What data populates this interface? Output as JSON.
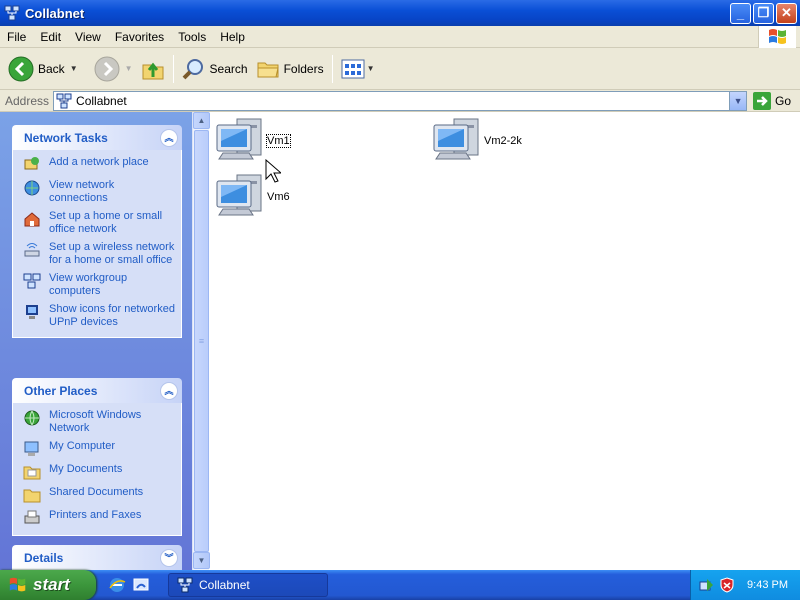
{
  "window": {
    "title": "Collabnet",
    "icon": "network-icon",
    "controls": [
      "minimize-icon",
      "maximize-icon",
      "close-icon"
    ]
  },
  "menubar": {
    "items": [
      "File",
      "Edit",
      "View",
      "Favorites",
      "Tools",
      "Help"
    ]
  },
  "toolbar": {
    "back_label": "Back",
    "search_label": "Search",
    "folders_label": "Folders"
  },
  "address": {
    "label": "Address",
    "value": "Collabnet",
    "go_label": "Go"
  },
  "network_tasks": {
    "title": "Network Tasks",
    "items": [
      {
        "label": "Add a network place",
        "icon": "add-network-place-icon"
      },
      {
        "label": "View network connections",
        "icon": "network-connections-icon"
      },
      {
        "label": "Set up a home or small office network",
        "icon": "home-network-icon"
      },
      {
        "label": "Set up a wireless network for a home or small office",
        "icon": "wireless-network-icon"
      },
      {
        "label": "View workgroup computers",
        "icon": "workgroup-icon"
      },
      {
        "label": "Show icons for networked UPnP devices",
        "icon": "upnp-icon"
      }
    ]
  },
  "other_places": {
    "title": "Other Places",
    "items": [
      {
        "label": "Microsoft Windows Network",
        "icon": "windows-network-icon"
      },
      {
        "label": "My Computer",
        "icon": "my-computer-icon"
      },
      {
        "label": "My Documents",
        "icon": "my-documents-icon"
      },
      {
        "label": "Shared Documents",
        "icon": "shared-documents-icon"
      },
      {
        "label": "Printers and Faxes",
        "icon": "printers-icon"
      }
    ]
  },
  "details": {
    "title": "Details"
  },
  "computers": [
    {
      "name": "Vm1",
      "selected": true
    },
    {
      "name": "Vm2-2k",
      "selected": false
    },
    {
      "name": "Vm6",
      "selected": false
    }
  ],
  "taskbar": {
    "start_label": "start",
    "task_label": "Collabnet",
    "time": "9:43 PM"
  },
  "colors": {
    "title_bar": "#0a4fd6",
    "task_link": "#215dc6",
    "panel_bg": "#6375d6",
    "taskbar": "#245edb",
    "start": "#3c963c"
  }
}
